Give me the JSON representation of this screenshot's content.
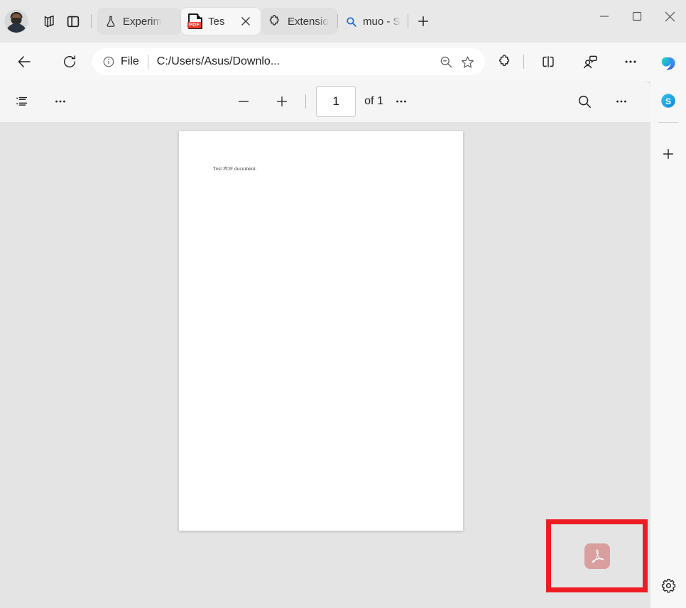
{
  "window": {
    "minimize_label": "Minimize",
    "maximize_label": "Maximize",
    "close_label": "Close"
  },
  "tabstrip": {
    "avatar_name": "profile-avatar",
    "collections_label": "Tab actions",
    "split_label": "Split screen",
    "tabs": [
      {
        "title": "Experim",
        "icon": "flask-icon",
        "active": false,
        "has_close": false
      },
      {
        "title": "Tes",
        "icon": "pdf-file-icon",
        "active": true,
        "has_close": true
      },
      {
        "title": "Extensio",
        "icon": "extensions-puzzle-icon",
        "active": false,
        "has_close": false
      },
      {
        "title": "muo - S",
        "icon": "search-icon",
        "active": false,
        "has_close": false
      }
    ],
    "new_tab_label": "+"
  },
  "navbar": {
    "back_label": "Back",
    "refresh_label": "Refresh",
    "info_label": "File information",
    "scheme_label": "File",
    "url": "C:/Users/Asus/Downlo...",
    "zoom_out_label": "Zoom out",
    "favorite_label": "Add to favorites",
    "extensions_label": "Extensions",
    "split_label": "Split screen",
    "share_label": "Share",
    "settings_more_label": "Settings and more",
    "copilot_label": "Copilot"
  },
  "rail": {
    "copilot_label": "Copilot",
    "skype_label": "S",
    "add_label": "+",
    "settings_label": "Settings"
  },
  "pdf_toolbar": {
    "toc_label": "Table of contents",
    "tools_more_label": "More tools",
    "zoom_out_label": "Zoom out",
    "zoom_in_label": "Zoom in",
    "page_number": "1",
    "of_pages": "of 1",
    "page_more_label": "More page options",
    "search_label": "Search",
    "more_label": "More options"
  },
  "document": {
    "body_text": "Test PDF document."
  },
  "annotation": {
    "box_color": "#ed1c24",
    "icon_label": "adobe-acrobat-icon",
    "icon_color": "#d99f9f"
  }
}
